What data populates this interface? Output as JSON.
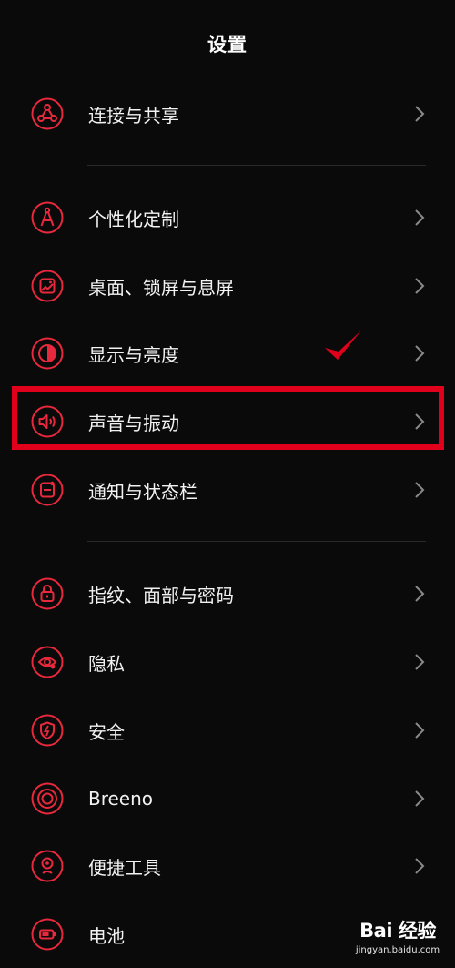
{
  "header": {
    "title": "设置"
  },
  "settings": [
    {
      "label": "连接与共享",
      "icon": "share-nodes-icon"
    },
    {
      "label": "个性化定制",
      "icon": "compass-icon"
    },
    {
      "label": "桌面、锁屏与息屏",
      "icon": "wallpaper-icon"
    },
    {
      "label": "显示与亮度",
      "icon": "half-circle-brightness-icon"
    },
    {
      "label": "声音与振动",
      "icon": "speaker-icon"
    },
    {
      "label": "通知与状态栏",
      "icon": "notification-bar-icon"
    },
    {
      "label": "指纹、面部与密码",
      "icon": "lock-icon"
    },
    {
      "label": "隐私",
      "icon": "privacy-eye-icon"
    },
    {
      "label": "安全",
      "icon": "shield-icon"
    },
    {
      "label": "Breeno",
      "icon": "breeno-ring-icon"
    },
    {
      "label": "便捷工具",
      "icon": "gesture-icon"
    },
    {
      "label": "电池",
      "icon": "battery-icon"
    }
  ],
  "annotation": {
    "highlighted_item": "声音与振动",
    "color": "#e0001b"
  },
  "watermark": {
    "logo": "Bai 经验",
    "domain": "jingyan.baidu.com"
  },
  "colors": {
    "accent": "#e8283c",
    "background": "#0a0a0a",
    "text": "#f2f2f2",
    "chevron": "#8a8a8a"
  }
}
